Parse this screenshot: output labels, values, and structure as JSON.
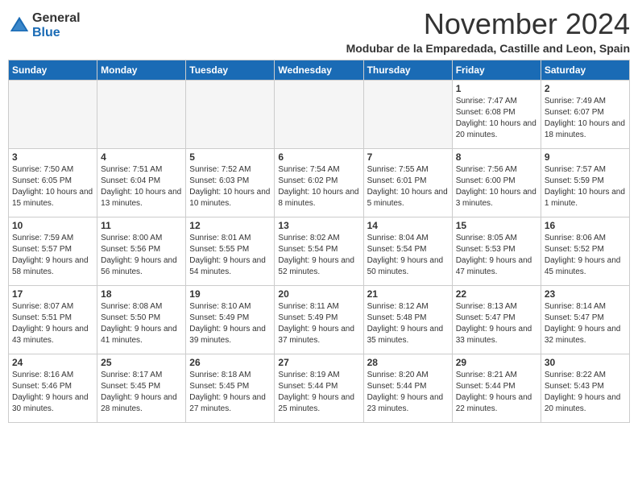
{
  "logo": {
    "general": "General",
    "blue": "Blue"
  },
  "header": {
    "month": "November 2024",
    "location": "Modubar de la Emparedada, Castille and Leon, Spain"
  },
  "weekdays": [
    "Sunday",
    "Monday",
    "Tuesday",
    "Wednesday",
    "Thursday",
    "Friday",
    "Saturday"
  ],
  "weeks": [
    [
      {
        "day": "",
        "info": ""
      },
      {
        "day": "",
        "info": ""
      },
      {
        "day": "",
        "info": ""
      },
      {
        "day": "",
        "info": ""
      },
      {
        "day": "",
        "info": ""
      },
      {
        "day": "1",
        "info": "Sunrise: 7:47 AM\nSunset: 6:08 PM\nDaylight: 10 hours and 20 minutes."
      },
      {
        "day": "2",
        "info": "Sunrise: 7:49 AM\nSunset: 6:07 PM\nDaylight: 10 hours and 18 minutes."
      }
    ],
    [
      {
        "day": "3",
        "info": "Sunrise: 7:50 AM\nSunset: 6:05 PM\nDaylight: 10 hours and 15 minutes."
      },
      {
        "day": "4",
        "info": "Sunrise: 7:51 AM\nSunset: 6:04 PM\nDaylight: 10 hours and 13 minutes."
      },
      {
        "day": "5",
        "info": "Sunrise: 7:52 AM\nSunset: 6:03 PM\nDaylight: 10 hours and 10 minutes."
      },
      {
        "day": "6",
        "info": "Sunrise: 7:54 AM\nSunset: 6:02 PM\nDaylight: 10 hours and 8 minutes."
      },
      {
        "day": "7",
        "info": "Sunrise: 7:55 AM\nSunset: 6:01 PM\nDaylight: 10 hours and 5 minutes."
      },
      {
        "day": "8",
        "info": "Sunrise: 7:56 AM\nSunset: 6:00 PM\nDaylight: 10 hours and 3 minutes."
      },
      {
        "day": "9",
        "info": "Sunrise: 7:57 AM\nSunset: 5:59 PM\nDaylight: 10 hours and 1 minute."
      }
    ],
    [
      {
        "day": "10",
        "info": "Sunrise: 7:59 AM\nSunset: 5:57 PM\nDaylight: 9 hours and 58 minutes."
      },
      {
        "day": "11",
        "info": "Sunrise: 8:00 AM\nSunset: 5:56 PM\nDaylight: 9 hours and 56 minutes."
      },
      {
        "day": "12",
        "info": "Sunrise: 8:01 AM\nSunset: 5:55 PM\nDaylight: 9 hours and 54 minutes."
      },
      {
        "day": "13",
        "info": "Sunrise: 8:02 AM\nSunset: 5:54 PM\nDaylight: 9 hours and 52 minutes."
      },
      {
        "day": "14",
        "info": "Sunrise: 8:04 AM\nSunset: 5:54 PM\nDaylight: 9 hours and 50 minutes."
      },
      {
        "day": "15",
        "info": "Sunrise: 8:05 AM\nSunset: 5:53 PM\nDaylight: 9 hours and 47 minutes."
      },
      {
        "day": "16",
        "info": "Sunrise: 8:06 AM\nSunset: 5:52 PM\nDaylight: 9 hours and 45 minutes."
      }
    ],
    [
      {
        "day": "17",
        "info": "Sunrise: 8:07 AM\nSunset: 5:51 PM\nDaylight: 9 hours and 43 minutes."
      },
      {
        "day": "18",
        "info": "Sunrise: 8:08 AM\nSunset: 5:50 PM\nDaylight: 9 hours and 41 minutes."
      },
      {
        "day": "19",
        "info": "Sunrise: 8:10 AM\nSunset: 5:49 PM\nDaylight: 9 hours and 39 minutes."
      },
      {
        "day": "20",
        "info": "Sunrise: 8:11 AM\nSunset: 5:49 PM\nDaylight: 9 hours and 37 minutes."
      },
      {
        "day": "21",
        "info": "Sunrise: 8:12 AM\nSunset: 5:48 PM\nDaylight: 9 hours and 35 minutes."
      },
      {
        "day": "22",
        "info": "Sunrise: 8:13 AM\nSunset: 5:47 PM\nDaylight: 9 hours and 33 minutes."
      },
      {
        "day": "23",
        "info": "Sunrise: 8:14 AM\nSunset: 5:47 PM\nDaylight: 9 hours and 32 minutes."
      }
    ],
    [
      {
        "day": "24",
        "info": "Sunrise: 8:16 AM\nSunset: 5:46 PM\nDaylight: 9 hours and 30 minutes."
      },
      {
        "day": "25",
        "info": "Sunrise: 8:17 AM\nSunset: 5:45 PM\nDaylight: 9 hours and 28 minutes."
      },
      {
        "day": "26",
        "info": "Sunrise: 8:18 AM\nSunset: 5:45 PM\nDaylight: 9 hours and 27 minutes."
      },
      {
        "day": "27",
        "info": "Sunrise: 8:19 AM\nSunset: 5:44 PM\nDaylight: 9 hours and 25 minutes."
      },
      {
        "day": "28",
        "info": "Sunrise: 8:20 AM\nSunset: 5:44 PM\nDaylight: 9 hours and 23 minutes."
      },
      {
        "day": "29",
        "info": "Sunrise: 8:21 AM\nSunset: 5:44 PM\nDaylight: 9 hours and 22 minutes."
      },
      {
        "day": "30",
        "info": "Sunrise: 8:22 AM\nSunset: 5:43 PM\nDaylight: 9 hours and 20 minutes."
      }
    ]
  ]
}
